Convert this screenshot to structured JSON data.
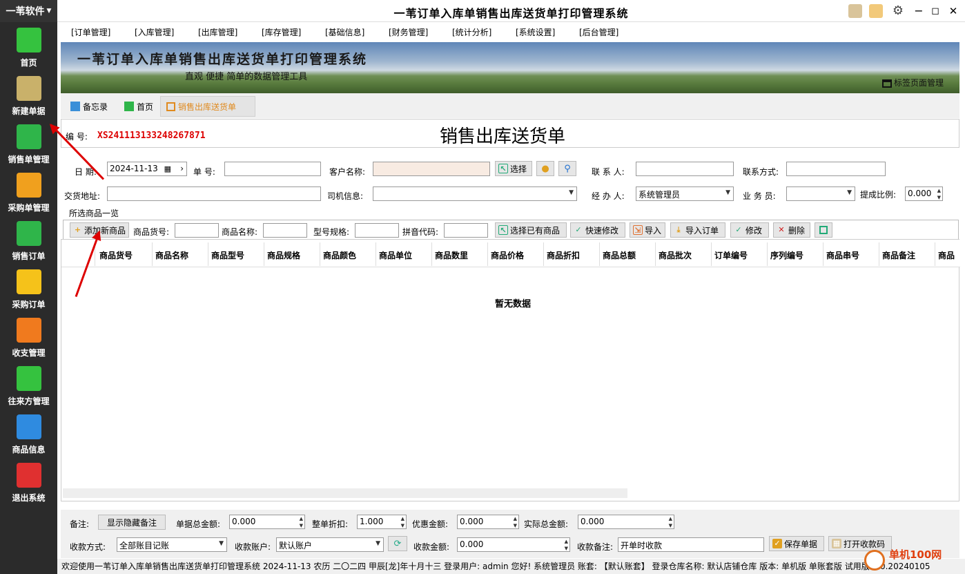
{
  "brand": "一苇软件",
  "sidebar": {
    "items": [
      {
        "label": "首页",
        "color": "#35c23f"
      },
      {
        "label": "新建单据",
        "color": "#c9b16a"
      },
      {
        "label": "销售单管理",
        "color": "#2fb54a"
      },
      {
        "label": "采购单管理",
        "color": "#f0a01e"
      },
      {
        "label": "销售订单",
        "color": "#2fb54a"
      },
      {
        "label": "采购订单",
        "color": "#f5c21a"
      },
      {
        "label": "收支管理",
        "color": "#f07a1e"
      },
      {
        "label": "往来方管理",
        "color": "#35c23f"
      },
      {
        "label": "商品信息",
        "color": "#2f8be0"
      },
      {
        "label": "退出系统",
        "color": "#e03030"
      }
    ]
  },
  "app_title": "一苇订单入库单销售出库送货单打印管理系统",
  "menu": [
    "[订单管理]",
    "[入库管理]",
    "[出库管理]",
    "[库存管理]",
    "[基础信息]",
    "[财务管理]",
    "[统计分析]",
    "[系统设置]",
    "[后台管理]"
  ],
  "banner": {
    "title": "一苇订单入库单销售出库送货单打印管理系统",
    "subtitle": "直观 便捷 简单的数据管理工具",
    "tag_manager": "标签页面管理"
  },
  "tabs": [
    {
      "label": "备忘录"
    },
    {
      "label": "首页"
    },
    {
      "label": "销售出库送货单"
    }
  ],
  "doc": {
    "num_label": "编 号:",
    "num": "XS241113133248267871",
    "title": "销售出库送货单"
  },
  "form": {
    "date_label": "日 期:",
    "date": "2024-11-13",
    "order_no_label": "单 号:",
    "customer_label": "客户名称:",
    "select_btn": "选择",
    "contact_label": "联 系 人:",
    "contact_way_label": "联系方式:",
    "address_label": "交货地址:",
    "driver_label": "司机信息:",
    "handler_label": "经 办 人:",
    "handler": "系统管理员",
    "salesman_label": "业 务 员:",
    "commission_label": "提成比例:",
    "commission": "0.000"
  },
  "goods": {
    "section_label": "所选商品一览",
    "add_btn": "添加新商品",
    "code_label": "商品货号:",
    "name_label": "商品名称:",
    "spec_label": "型号规格:",
    "pinyin_label": "拼音代码:",
    "select_exist_btn": "选择已有商品",
    "quick_edit_btn": "快速修改",
    "import_btn": "导入",
    "import_order_btn": "导入订单",
    "edit_btn": "修改",
    "delete_btn": "删除"
  },
  "grid": {
    "columns": [
      "商品货号",
      "商品名称",
      "商品型号",
      "商品规格",
      "商品颜色",
      "商品单位",
      "商品数里",
      "商品价格",
      "商品折扣",
      "商品总额",
      "商品批次",
      "订单编号",
      "序列编号",
      "商品串号",
      "商品备注",
      "商品"
    ],
    "empty": "暂无数据"
  },
  "bottom": {
    "remark_label": "备注:",
    "toggle_remark_btn": "显示隐藏备注",
    "total_label": "单据总金额:",
    "total": "0.000",
    "discount_label": "整单折扣:",
    "discount": "1.000",
    "favor_label": "优惠金额:",
    "favor": "0.000",
    "actual_label": "实际总金额:",
    "actual": "0.000",
    "pay_method_label": "收款方式:",
    "pay_method": "全部账目记账",
    "account_label": "收款账户:",
    "account": "默认账户",
    "received_label": "收款金额:",
    "received": "0.000",
    "pay_note_label": "收款备注:",
    "pay_note": "开单时收款",
    "save_btn": "保存单据",
    "print_btn": "打开收款码"
  },
  "status": "欢迎使用一苇订单入库单销售出库送货单打印管理系统 2024-11-13 农历 二〇二四 甲辰[龙]年十月十三 登录用户: admin 您好! 系统管理员 账套: 【默认账套】 登录仓库名称: 默认店铺仓库 版本: 单机版 单账套版 试用版 1.0.20240105",
  "watermark": "单机100网"
}
